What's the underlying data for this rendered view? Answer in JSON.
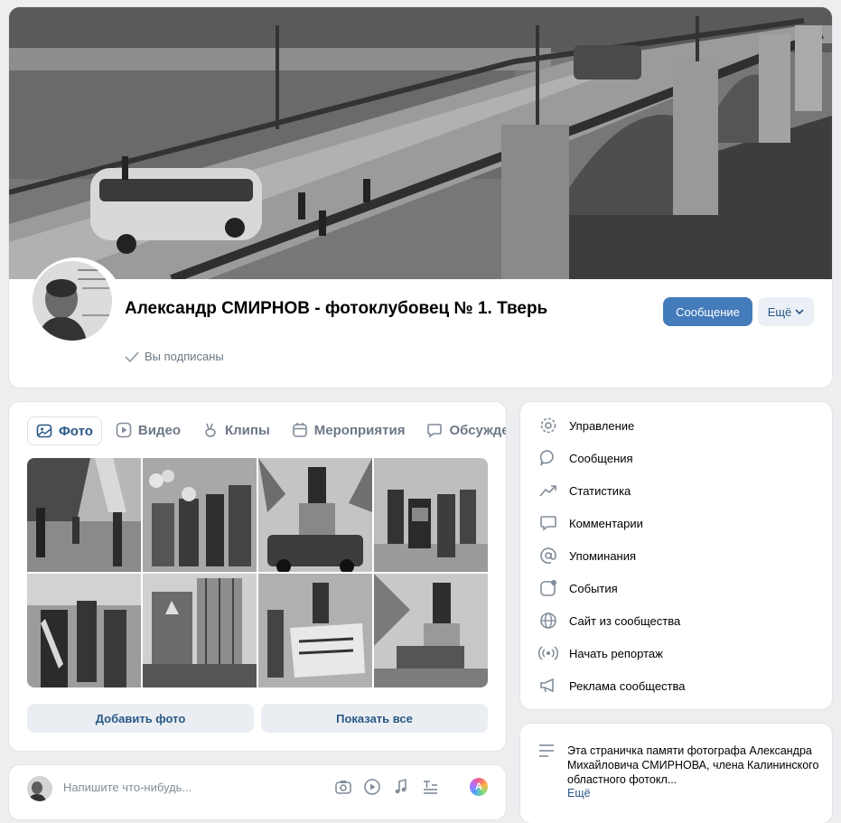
{
  "header": {
    "title": "Александр СМИРНОВ - фотоклубовец № 1. Тверь",
    "subscribed_label": "Вы подписаны",
    "message_button": "Сообщение",
    "more_button": "Ещё"
  },
  "media": {
    "tabs": [
      {
        "label": "Фото",
        "icon": "photo-icon",
        "active": true
      },
      {
        "label": "Видео",
        "icon": "video-icon"
      },
      {
        "label": "Клипы",
        "icon": "clips-icon"
      },
      {
        "label": "Мероприятия",
        "icon": "calendar-icon"
      },
      {
        "label": "Обсуждения",
        "icon": "discussion-icon"
      }
    ],
    "add_photo_button": "Добавить фото",
    "show_all_button": "Показать все"
  },
  "composer": {
    "placeholder": "Напишите что-нибудь..."
  },
  "manage_menu": {
    "items": [
      {
        "label": "Управление",
        "icon": "gear-icon"
      },
      {
        "label": "Сообщения",
        "icon": "message-bubble-icon"
      },
      {
        "label": "Статистика",
        "icon": "statistics-icon"
      },
      {
        "label": "Комментарии",
        "icon": "comment-icon"
      },
      {
        "label": "Упоминания",
        "icon": "at-icon"
      },
      {
        "label": "События",
        "icon": "events-icon"
      },
      {
        "label": "Сайт из сообщества",
        "icon": "globe-icon"
      },
      {
        "label": "Начать репортаж",
        "icon": "broadcast-icon"
      },
      {
        "label": "Реклама сообщества",
        "icon": "megaphone-icon"
      }
    ]
  },
  "description": {
    "text": "Эта страничка памяти фотографа Александра Михайловича СМИРНОВА, члена Калининского областного фотокл...",
    "more_link": "Ещё"
  },
  "colors": {
    "page_background": "#edeef0",
    "primary_button": "#447bba",
    "link": "#2a5885",
    "secondary_text": "#6d7885"
  }
}
